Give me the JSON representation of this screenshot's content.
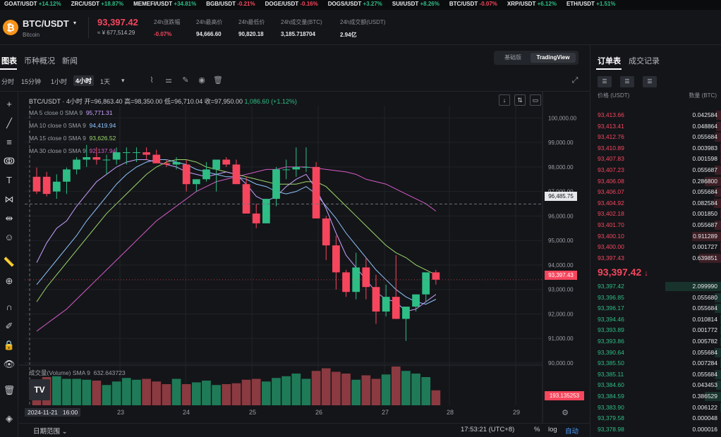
{
  "ticker": [
    {
      "sym": "GOAT/USDT",
      "chg": "+14.12%",
      "dir": "up"
    },
    {
      "sym": "ZRC/USDT",
      "chg": "+18.87%",
      "dir": "up"
    },
    {
      "sym": "MEMEFI/USDT",
      "chg": "+34.81%",
      "dir": "up"
    },
    {
      "sym": "BGB/USDT",
      "chg": "-0.21%",
      "dir": "dn"
    },
    {
      "sym": "DOGE/USDT",
      "chg": "-0.16%",
      "dir": "dn"
    },
    {
      "sym": "DOGS/USDT",
      "chg": "+3.27%",
      "dir": "up"
    },
    {
      "sym": "SUI/USDT",
      "chg": "+8.26%",
      "dir": "up"
    },
    {
      "sym": "BTC/USDT",
      "chg": "-0.07%",
      "dir": "dn"
    },
    {
      "sym": "XRP/USDT",
      "chg": "+6.12%",
      "dir": "up"
    },
    {
      "sym": "ETH/USDT",
      "chg": "+1.51%",
      "dir": "up"
    }
  ],
  "header": {
    "coin_icon": "₿",
    "pair": "BTC/USDT",
    "pair_caret": "▾",
    "coin_name": "Bitcoin",
    "last_price": "93,397.42",
    "cny_price": "≈ ¥ 677,514.29",
    "stats": [
      {
        "label": "24h涨跌幅",
        "value": "-0.07%",
        "color": "#f6465d"
      },
      {
        "label": "24h最高价",
        "value": "94,666.60",
        "color": "#e6e8ea"
      },
      {
        "label": "24h最低价",
        "value": "90,820.18",
        "color": "#e6e8ea"
      },
      {
        "label": "24h成交量(BTC)",
        "value": "3,185.718704",
        "color": "#e6e8ea"
      },
      {
        "label": "24h成交额(USDT)",
        "value": "2.94亿",
        "color": "#e6e8ea"
      }
    ]
  },
  "tabs": {
    "chart": "图表",
    "overview": "币种概况",
    "news": "新闻",
    "basic": "基础版",
    "tradingview": "TradingView"
  },
  "intervals": {
    "time": "分时",
    "m15": "15分钟",
    "h1": "1小时",
    "h4": "4小时",
    "d1": "1天",
    "more": "▾"
  },
  "chart_info": {
    "ohlc": "BTC/USDT · 4小时  开=96,863.40 高=98,350.00 低=96,710.04 收=97,950.00 ",
    "change": "1,086.60 (+1.12%)",
    "ma5": "MA 5 close 0 SMA 9",
    "ma5v": "95,771.31",
    "ma10": "MA 10 close 0 SMA 9",
    "ma10v": "94,419.94",
    "ma15": "MA 15 close 0 SMA 9",
    "ma15v": "93,626.52",
    "ma30": "MA 30 close 0 SMA 9",
    "ma30v": "92,137.94",
    "vol": "成交量(Volume) SMA 9",
    "volv": "632.643723",
    "cursor_price": "96,485.75",
    "last_tag": "93,397.43",
    "vol_tag": "193.135253",
    "cursor_date": "2024-11-21   16:00",
    "logo": "TV"
  },
  "chart_data": {
    "type": "candlestick",
    "interval": "4小时",
    "ylim": [
      90000,
      100500
    ],
    "y_ticks": [
      "100,000.00",
      "99,000.00",
      "98,000.00",
      "97,000.00",
      "96,000.00",
      "95,000.00",
      "94,000.00",
      "93,000.00",
      "92,000.00",
      "91,000.00",
      "90,000.00"
    ],
    "x_ticks": [
      "23",
      "24",
      "25",
      "26",
      "27",
      "28",
      "29"
    ],
    "candles": [
      [
        97600,
        97980,
        96900,
        97000
      ],
      [
        97600,
        97800,
        96800,
        96900
      ],
      [
        97000,
        97700,
        96700,
        97400
      ],
      [
        97400,
        97980,
        96900,
        97900
      ],
      [
        97900,
        98400,
        97700,
        98300
      ],
      [
        98300,
        98900,
        98000,
        98400
      ],
      [
        98400,
        98800,
        98100,
        98300
      ],
      [
        98300,
        98500,
        97700,
        98300
      ],
      [
        98300,
        98800,
        98100,
        98600
      ],
      [
        98600,
        98800,
        98100,
        98600
      ],
      [
        98600,
        98800,
        98200,
        98600
      ],
      [
        98600,
        98800,
        98300,
        98500
      ],
      [
        98500,
        98700,
        98200,
        98150
      ],
      [
        98150,
        98300,
        98000,
        98100
      ],
      [
        98100,
        98400,
        97900,
        98200
      ],
      [
        98100,
        98300,
        97000,
        97300
      ],
      [
        97300,
        97500,
        97000,
        97500
      ],
      [
        97500,
        98200,
        97400,
        97900
      ],
      [
        97900,
        98100,
        97000,
        98300
      ],
      [
        98300,
        98400,
        98000,
        98100
      ],
      [
        98100,
        98300,
        97500,
        97300
      ],
      [
        97300,
        97600,
        96200,
        96100
      ],
      [
        96100,
        96500,
        95500,
        95700
      ],
      [
        95700,
        96600,
        95800,
        96700
      ],
      [
        96700,
        98000,
        96400,
        97900
      ],
      [
        97900,
        98300,
        97500,
        97900
      ],
      [
        97900,
        98800,
        97600,
        98000
      ],
      [
        98000,
        98800,
        97800,
        98000
      ],
      [
        98000,
        98200,
        95900,
        95900
      ],
      [
        95900,
        96000,
        94200,
        94800
      ],
      [
        94800,
        95200,
        93000,
        93700
      ],
      [
        93700,
        93800,
        92700,
        92900
      ],
      [
        92900,
        94500,
        92600,
        93900
      ],
      [
        93900,
        94300,
        92600,
        93100
      ],
      [
        93100,
        93600,
        91600,
        92100
      ],
      [
        92100,
        93200,
        91900,
        92700
      ],
      [
        92700,
        94400,
        91800,
        91800
      ],
      [
        91800,
        92300,
        90900,
        92300
      ],
      [
        92300,
        92800,
        92100,
        92800
      ],
      [
        92800,
        93600,
        92500,
        93700
      ],
      [
        93700,
        93800,
        93200,
        93400
      ]
    ],
    "volume": [
      260,
      320,
      330,
      300,
      300,
      290,
      280,
      230,
      270,
      310,
      290,
      300,
      270,
      240,
      300,
      240,
      260,
      280,
      230,
      240,
      250,
      290,
      300,
      270,
      310,
      330,
      360,
      300,
      390,
      420,
      380,
      360,
      290,
      340,
      300,
      350,
      440,
      390,
      360,
      320,
      170
    ],
    "ma5": [
      94100,
      94900,
      95500,
      95800,
      96400,
      96900,
      97400,
      97700,
      98000,
      98200,
      98300,
      98300,
      98200,
      98100,
      98000,
      97800,
      97700,
      97600,
      97700,
      97800,
      97700,
      97300,
      96800,
      96600,
      96800,
      97200,
      97500,
      97700,
      97100,
      96300,
      95300,
      94400,
      93900,
      93400,
      92900,
      92600,
      92500,
      92100,
      92200,
      92500,
      92800
    ],
    "ma10": [
      93200,
      93700,
      94200,
      94700,
      95200,
      95800,
      96300,
      96800,
      97300,
      97700,
      98000,
      98200,
      98300,
      98300,
      98200,
      98100,
      97900,
      97800,
      97700,
      97600,
      97600,
      97500,
      97300,
      97200,
      97000,
      96900,
      97000,
      97200,
      96900,
      96400,
      95900,
      95300,
      94800,
      94300,
      93800,
      93400,
      93000,
      92700,
      92500,
      92400,
      92600
    ],
    "ma15": [
      92500,
      93100,
      93600,
      94100,
      94600,
      95100,
      95600,
      96100,
      96500,
      96900,
      97300,
      97700,
      98000,
      98200,
      98300,
      98300,
      98200,
      98000,
      97900,
      97800,
      97700,
      97600,
      97500,
      97400,
      97300,
      97300,
      97300,
      97400,
      97400,
      97200,
      96800,
      96400,
      96000,
      95600,
      95200,
      94800,
      94500,
      94300,
      94000,
      93800,
      93600
    ],
    "ma30": [
      91300,
      91600,
      91900,
      92200,
      92600,
      93000,
      93400,
      93800,
      94200,
      94600,
      95000,
      95400,
      95800,
      96100,
      96400,
      96700,
      97000,
      97200,
      97400,
      97500,
      97600,
      97700,
      97800,
      97900,
      97900,
      98000,
      98000,
      98000,
      97950,
      97900,
      97850,
      97800,
      97700,
      97500,
      97400,
      97300,
      97100,
      96900,
      96700,
      96500,
      96200
    ]
  },
  "bottom": {
    "range": "日期范围 ⌄",
    "time": "17:53:21 (UTC+8)",
    "pct": "%",
    "log": "log",
    "auto": "自动",
    "gear": "⚙"
  },
  "orderbook": {
    "tab_book": "订单表",
    "tab_trades": "成交记录",
    "price_hdr": "价格 (USDT)",
    "qty_hdr": "数量 (BTC)",
    "last": "93,397.42",
    "last_arrow": "↓",
    "asks": [
      [
        "93,413.66",
        "0.042584",
        0.1
      ],
      [
        "93,413.41",
        "0.048864",
        0.1
      ],
      [
        "93,412.76",
        "0.055684",
        0.12
      ],
      [
        "93,410.89",
        "0.003983",
        0.02
      ],
      [
        "93,407.83",
        "0.001598",
        0.02
      ],
      [
        "93,407.23",
        "0.055687",
        0.12
      ],
      [
        "93,406.08",
        "0.286800",
        0.3
      ],
      [
        "93,406.07",
        "0.055684",
        0.12
      ],
      [
        "93,404.92",
        "0.082584",
        0.14
      ],
      [
        "93,402.18",
        "0.001850",
        0.02
      ],
      [
        "93,401.70",
        "0.055687",
        0.12
      ],
      [
        "93,400.10",
        "0.911289",
        0.52
      ],
      [
        "93,400.00",
        "0.001727",
        0.02
      ],
      [
        "93,397.43",
        "0.639851",
        0.4
      ]
    ],
    "bids": [
      [
        "93,397.42",
        "2.099990",
        1.0
      ],
      [
        "93,396.85",
        "0.055680",
        0.12
      ],
      [
        "93,396.17",
        "0.055684",
        0.12
      ],
      [
        "93,394.46",
        "0.010814",
        0.03
      ],
      [
        "93,393.89",
        "0.001772",
        0.02
      ],
      [
        "93,393.86",
        "0.005782",
        0.02
      ],
      [
        "93,390.64",
        "0.055684",
        0.12
      ],
      [
        "93,385.50",
        "0.007284",
        0.02
      ],
      [
        "93,385.11",
        "0.055684",
        0.12
      ],
      [
        "93,384.60",
        "0.043453",
        0.1
      ],
      [
        "93,384.59",
        "0.386529",
        0.3
      ],
      [
        "93,383.90",
        "0.006122",
        0.02
      ],
      [
        "93,379.58",
        "0.000048",
        0.01
      ],
      [
        "93,378.98",
        "0.000016",
        0.01
      ]
    ]
  },
  "colors": {
    "up": "#2ebd85",
    "down": "#f6465d",
    "ma5": "#c9a0ff",
    "ma10": "#8ec5ff",
    "ma15": "#9bd86a",
    "ma30": "#d65bc7"
  }
}
